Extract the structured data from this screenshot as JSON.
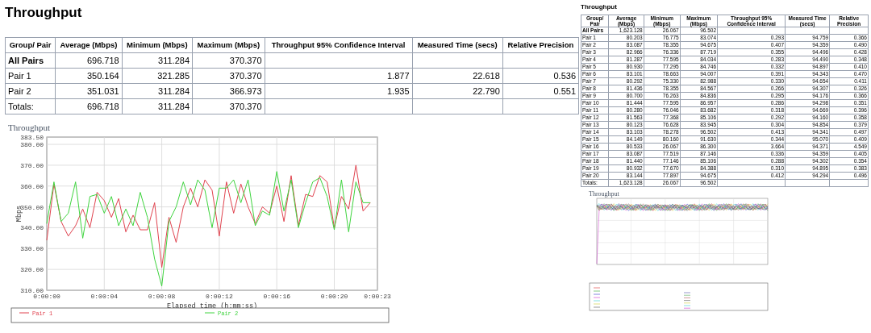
{
  "left": {
    "title": "Throughput",
    "table": {
      "columns": [
        "Group/ Pair",
        "Average (Mbps)",
        "Minimum (Mbps)",
        "Maximum (Mbps)",
        "Throughput 95% Confidence Interval",
        "Measured Time (secs)",
        "Relative Precision"
      ],
      "rows": [
        {
          "kind": "all",
          "cells": [
            "All Pairs",
            "696.718",
            "311.284",
            "370.370"
          ]
        },
        {
          "kind": "pair",
          "cells": [
            "Pair 1",
            "350.164",
            "321.285",
            "370.370",
            "1.877",
            "22.618",
            "0.536"
          ]
        },
        {
          "kind": "pair",
          "cells": [
            "Pair 2",
            "351.031",
            "311.284",
            "366.973",
            "1.935",
            "22.790",
            "0.551"
          ]
        },
        {
          "kind": "total",
          "cells": [
            "Totals:",
            "696.718",
            "311.284",
            "370.370"
          ]
        }
      ]
    },
    "chart": {
      "chart_data": {
        "type": "line",
        "title": "Throughput",
        "xlabel": "Elapsed time (h:mm:ss)",
        "ylabel": "Mbps",
        "x": [
          0,
          0.5,
          1,
          1.5,
          2,
          2.5,
          3,
          3.5,
          4,
          4.5,
          5,
          5.5,
          6,
          6.5,
          7,
          7.5,
          8,
          8.5,
          9,
          9.5,
          10,
          10.5,
          11,
          11.5,
          12,
          12.5,
          13,
          13.5,
          14,
          14.5,
          15,
          15.5,
          16,
          16.5,
          17,
          17.5,
          18,
          18.5,
          19,
          19.5,
          20,
          20.5,
          21,
          21.5,
          22,
          22.5
        ],
        "series": [
          {
            "name": "Pair 1",
            "color": "#e0424e",
            "values": [
              334,
              361,
              343,
              336,
              341,
              349,
              340,
              357,
              353,
              345,
              354,
              338,
              346,
              339,
              339,
              352,
              321,
              345,
              333,
              350,
              359,
              350,
              363,
              358,
              336,
              362,
              347,
              361,
              350,
              342,
              350,
              347,
              360,
              343,
              365,
              341,
              356,
              355,
              365,
              362,
              340,
              355,
              349,
              370,
              348,
              352
            ]
          },
          {
            "name": "Pair 2",
            "color": "#3ed43e",
            "values": [
              342,
              362,
              343,
              347,
              362,
              335,
              355,
              356,
              347,
              355,
              341,
              349,
              341,
              357,
              345,
              325,
              312,
              343,
              350,
              362,
              351,
              363,
              358,
              340,
              359,
              359,
              363,
              352,
              363,
              341,
              348,
              346,
              367,
              348,
              363,
              340,
              352,
              362,
              364,
              355,
              339,
              363,
              338,
              362,
              352,
              352
            ]
          }
        ],
        "xlim": [
          0,
          23
        ],
        "ylim": [
          310,
          383.5
        ],
        "grid": true,
        "legend": true,
        "xticks": [
          {
            "value": 0,
            "label": "0:00:00"
          },
          {
            "value": 4,
            "label": "0:00:04"
          },
          {
            "value": 8,
            "label": "0:00:08"
          },
          {
            "value": 12,
            "label": "0:00:12"
          },
          {
            "value": 16,
            "label": "0:00:16"
          },
          {
            "value": 20,
            "label": "0:00:20"
          },
          {
            "value": 23,
            "label": "0:00:23"
          }
        ],
        "yticks": [
          {
            "value": 310,
            "label": "310.00"
          },
          {
            "value": 320,
            "label": "320.00"
          },
          {
            "value": 330,
            "label": "330.00"
          },
          {
            "value": 340,
            "label": "340.00"
          },
          {
            "value": 350,
            "label": "350.00"
          },
          {
            "value": 360,
            "label": "360.00"
          },
          {
            "value": 370,
            "label": "370.00"
          },
          {
            "value": 380,
            "label": "380.00"
          },
          {
            "value": 383.5,
            "label": "383.50"
          }
        ]
      }
    }
  },
  "right": {
    "title": "Throughput",
    "table": {
      "columns": [
        "Group/ Pair",
        "Average (Mbps)",
        "Minimum (Mbps)",
        "Maximum (Mbps)",
        "Throughput 95% Confidence Interval",
        "Measured Time (secs)",
        "Relative Precision"
      ],
      "rows": [
        {
          "kind": "all",
          "cells": [
            "All Pairs",
            "1,623.128",
            "26.067",
            "96.502"
          ]
        },
        {
          "kind": "pair",
          "cells": [
            "Pair 1",
            "80.203",
            "76.775",
            "83.074",
            "0.293",
            "94.759",
            "0.366"
          ]
        },
        {
          "kind": "pair",
          "cells": [
            "Pair 2",
            "83.087",
            "78.355",
            "94.675",
            "0.407",
            "94.359",
            "0.490"
          ]
        },
        {
          "kind": "pair",
          "cells": [
            "Pair 3",
            "82.966",
            "76.336",
            "87.719",
            "0.355",
            "94.496",
            "0.428"
          ]
        },
        {
          "kind": "pair",
          "cells": [
            "Pair 4",
            "81.287",
            "77.595",
            "84.034",
            "0.283",
            "94.490",
            "0.348"
          ]
        },
        {
          "kind": "pair",
          "cells": [
            "Pair 5",
            "80.930",
            "77.295",
            "84.746",
            "0.332",
            "94.897",
            "0.410"
          ]
        },
        {
          "kind": "pair",
          "cells": [
            "Pair 6",
            "83.101",
            "78.663",
            "94.007",
            "0.391",
            "94.343",
            "0.470"
          ]
        },
        {
          "kind": "pair",
          "cells": [
            "Pair 7",
            "80.292",
            "75.330",
            "82.988",
            "0.330",
            "94.654",
            "0.411"
          ]
        },
        {
          "kind": "pair",
          "cells": [
            "Pair 8",
            "81.436",
            "78.355",
            "84.567",
            "0.266",
            "94.307",
            "0.326"
          ]
        },
        {
          "kind": "pair",
          "cells": [
            "Pair 9",
            "80.700",
            "76.263",
            "84.836",
            "0.295",
            "94.176",
            "0.366"
          ]
        },
        {
          "kind": "pair",
          "cells": [
            "Pair 10",
            "81.444",
            "77.595",
            "86.957",
            "0.286",
            "94.298",
            "0.351"
          ]
        },
        {
          "kind": "pair",
          "cells": [
            "Pair 11",
            "80.280",
            "76.046",
            "83.682",
            "0.318",
            "94.669",
            "0.396"
          ]
        },
        {
          "kind": "pair",
          "cells": [
            "Pair 12",
            "81.563",
            "77.368",
            "85.106",
            "0.292",
            "94.160",
            "0.358"
          ]
        },
        {
          "kind": "pair",
          "cells": [
            "Pair 13",
            "80.123",
            "76.628",
            "83.945",
            "0.304",
            "94.854",
            "0.379"
          ]
        },
        {
          "kind": "pair",
          "cells": [
            "Pair 14",
            "83.103",
            "78.278",
            "96.502",
            "0.413",
            "94.341",
            "0.497"
          ]
        },
        {
          "kind": "pair",
          "cells": [
            "Pair 15",
            "84.149",
            "80.160",
            "91.630",
            "0.344",
            "95.070",
            "0.409"
          ]
        },
        {
          "kind": "pair",
          "cells": [
            "Pair 16",
            "80.533",
            "26.067",
            "86.300",
            "3.664",
            "94.371",
            "4.549"
          ]
        },
        {
          "kind": "pair",
          "cells": [
            "Pair 17",
            "83.087",
            "77.519",
            "87.146",
            "0.336",
            "94.359",
            "0.405"
          ]
        },
        {
          "kind": "pair",
          "cells": [
            "Pair 18",
            "81.440",
            "77.146",
            "85.106",
            "0.288",
            "94.302",
            "0.354"
          ]
        },
        {
          "kind": "pair",
          "cells": [
            "Pair 19",
            "80.932",
            "77.670",
            "84.388",
            "0.310",
            "94.895",
            "0.383"
          ]
        },
        {
          "kind": "pair",
          "cells": [
            "Pair 20",
            "83.144",
            "77.897",
            "94.675",
            "0.412",
            "94.294",
            "0.496"
          ]
        },
        {
          "kind": "total",
          "cells": [
            "Totals:",
            "1,623.128",
            "26.067",
            "96.502"
          ]
        }
      ]
    },
    "chart": {
      "title": "Throughput",
      "kind": "picture"
    }
  }
}
